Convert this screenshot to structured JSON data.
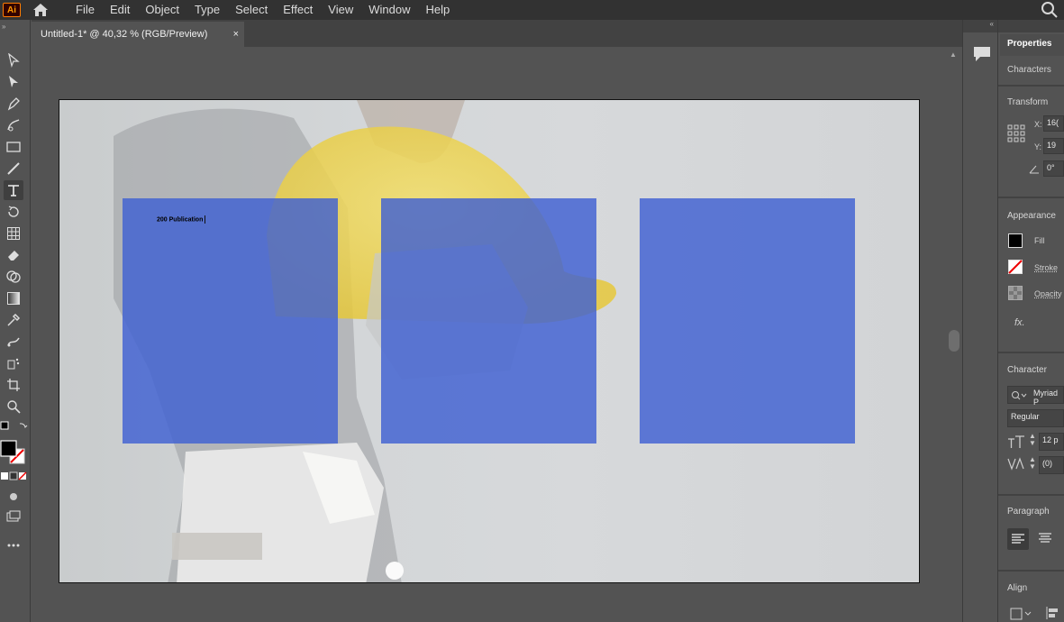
{
  "app": {
    "logo_text": "Ai"
  },
  "menu": [
    "File",
    "Edit",
    "Object",
    "Type",
    "Select",
    "Effect",
    "View",
    "Window",
    "Help"
  ],
  "document_tab": {
    "title": "Untitled-1* @ 40,32 % (RGB/Preview)",
    "close": "×"
  },
  "artboard": {
    "text_frame": "200 Publication",
    "box_color": "#4060d2"
  },
  "properties": {
    "tabs": {
      "properties": "Properties",
      "characters": "Characters"
    },
    "transform": {
      "title": "Transform",
      "x_label": "X:",
      "x_value": "16(",
      "y_label": "Y:",
      "y_value": "19",
      "angle_value": "0°"
    },
    "appearance": {
      "title": "Appearance",
      "fill": "Fill",
      "stroke": "Stroke",
      "opacity": "Opacity",
      "fx": "fx."
    },
    "character": {
      "title": "Character",
      "font": "Myriad P",
      "style": "Regular",
      "size": "12 p",
      "tracking": "(0)"
    },
    "paragraph": {
      "title": "Paragraph"
    },
    "align": {
      "title": "Align"
    }
  }
}
